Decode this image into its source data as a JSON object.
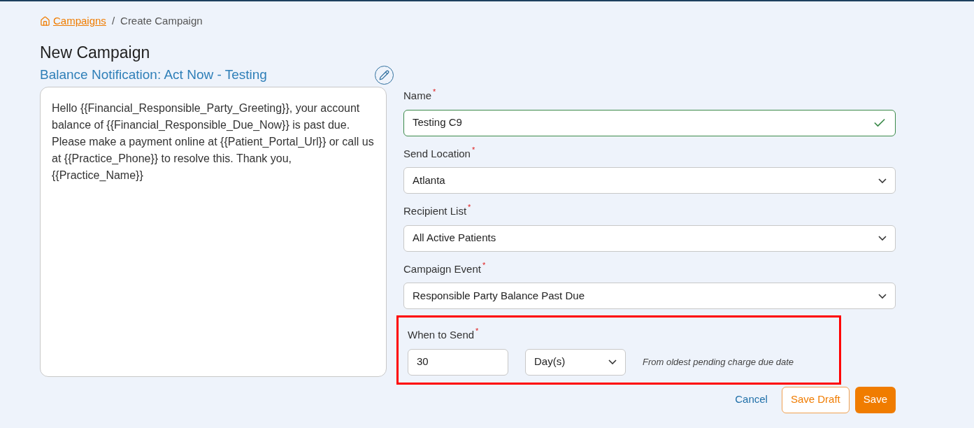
{
  "breadcrumb": {
    "link": "Campaigns",
    "separator": "/",
    "current": "Create Campaign"
  },
  "page_title": "New Campaign",
  "campaign_name": "Balance Notification: Act Now - Testing",
  "message": "Hello {{Financial_Responsible_Party_Greeting}}, your account balance of {{Financial_Responsible_Due_Now}} is past due. Please make a payment online at {{Patient_Portal_Url}} or call us at {{Practice_Phone}} to resolve this. Thank you, {{Practice_Name}}",
  "fields": [
    {
      "kind": "text",
      "label": "Name",
      "required_mark": "*",
      "value": "Testing C9",
      "valid": true
    },
    {
      "kind": "select",
      "label": "Send Location",
      "required_mark": "*",
      "value": "Atlanta"
    },
    {
      "kind": "select",
      "label": "Recipient List",
      "required_mark": "*",
      "value": "All Active Patients"
    },
    {
      "kind": "select",
      "label": "Campaign Event",
      "required_mark": "*",
      "value": "Responsible Party Balance Past Due"
    }
  ],
  "when_to_send": {
    "label": "When to Send",
    "required_mark": "*",
    "highlighted": true,
    "amount": "30",
    "unit": "Day(s)",
    "note": "From oldest pending charge due date"
  },
  "buttons": [
    {
      "kind": "link",
      "label": "Cancel"
    },
    {
      "kind": "outline",
      "label": "Save Draft"
    },
    {
      "kind": "primary",
      "label": "Save"
    }
  ]
}
